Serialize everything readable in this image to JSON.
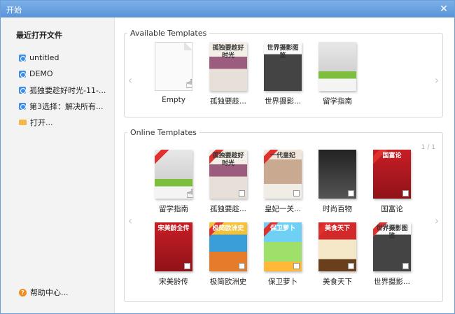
{
  "window": {
    "title": "开始",
    "close_icon": "close-icon"
  },
  "sidebar": {
    "heading": "最近打开文件",
    "items": [
      {
        "label": "untitled",
        "icon": "document-icon"
      },
      {
        "label": "DEMO",
        "icon": "document-icon"
      },
      {
        "label": "孤独要趁好时光-11-...",
        "icon": "document-icon"
      },
      {
        "label": "第3选择：解决所有...",
        "icon": "document-icon"
      },
      {
        "label": "打开...",
        "icon": "folder-icon"
      }
    ],
    "help": "帮助中心..."
  },
  "available": {
    "legend": "Available Templates",
    "templates": [
      {
        "label": "Empty"
      },
      {
        "label": "孤独要趁...",
        "cover_text": "孤独要趁好时光"
      },
      {
        "label": "世界摄影...",
        "cover_text": "世界摄影图鉴"
      },
      {
        "label": "留学指南"
      }
    ]
  },
  "online": {
    "legend": "Online Templates",
    "pager": "1 / 1",
    "templates": [
      {
        "label": "留学指南"
      },
      {
        "label": "孤独要趁...",
        "cover_text": "孤独要趁好时光"
      },
      {
        "label": "皇妃一关...",
        "cover_text": "一代皇妃"
      },
      {
        "label": "时尚百物"
      },
      {
        "label": "国富论",
        "cover_text": "国富论"
      },
      {
        "label": "宋美龄传",
        "cover_text": "宋美龄全传"
      },
      {
        "label": "极简欧洲史",
        "cover_text": "极简欧洲史"
      },
      {
        "label": "保卫萝卜",
        "cover_text": "保卫萝卜"
      },
      {
        "label": "美食天下",
        "cover_text": "美食天下"
      },
      {
        "label": "世界摄影...",
        "cover_text": "世界摄影图鉴"
      }
    ]
  }
}
